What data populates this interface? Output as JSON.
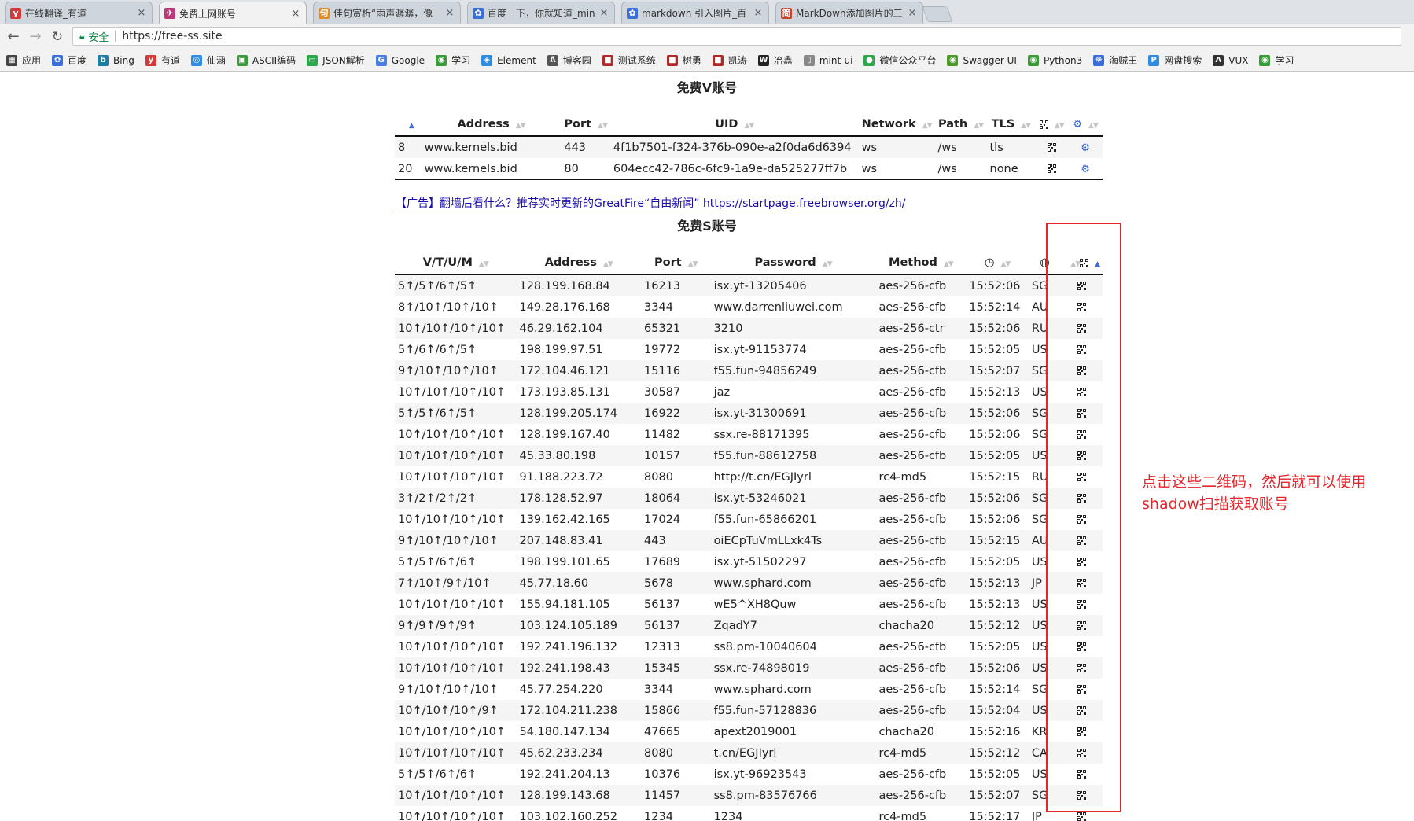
{
  "browser": {
    "tabs": [
      {
        "title": "在线翻译_有道",
        "icon_color": "#d43a3a",
        "icon": "y"
      },
      {
        "title": "免费上网账号",
        "icon_color": "#b83a78",
        "icon": "✈",
        "active": true
      },
      {
        "title": "佳句赏析“雨声潺潺，像",
        "icon_color": "#e08a2a",
        "icon": "句"
      },
      {
        "title": "百度一下，你就知道_min",
        "icon_color": "#3b6fd8",
        "icon": "✿"
      },
      {
        "title": "markdown 引入图片_百",
        "icon_color": "#3b6fd8",
        "icon": "✿"
      },
      {
        "title": "MarkDown添加图片的三",
        "icon_color": "#c8402e",
        "icon": "简"
      }
    ],
    "tab_close": "×",
    "security_label": "安全",
    "url": "https://free-ss.site",
    "bookmarks": [
      {
        "label": "应用",
        "color": "#444",
        "icon": "▦"
      },
      {
        "label": "百度",
        "color": "#3b6fd8",
        "icon": "✿"
      },
      {
        "label": "Bing",
        "color": "#1f7ea6",
        "icon": "b"
      },
      {
        "label": "有道",
        "color": "#d43a3a",
        "icon": "y"
      },
      {
        "label": "仙涵",
        "color": "#2f8be0",
        "icon": "◎"
      },
      {
        "label": "ASCII编码",
        "color": "#3a9a3a",
        "icon": "▣"
      },
      {
        "label": "JSON解析",
        "color": "#2aa84a",
        "icon": "▭"
      },
      {
        "label": "Google",
        "color": "#4a7de0",
        "icon": "G"
      },
      {
        "label": "学习",
        "color": "#3a9a3a",
        "icon": "◉"
      },
      {
        "label": "Element",
        "color": "#2f8be0",
        "icon": "◈"
      },
      {
        "label": "博客园",
        "color": "#555",
        "icon": "ᕕ"
      },
      {
        "label": "测试系统",
        "color": "#b02a2a",
        "icon": "■"
      },
      {
        "label": "树勇",
        "color": "#b02a2a",
        "icon": "■"
      },
      {
        "label": "凯涛",
        "color": "#b02a2a",
        "icon": "■"
      },
      {
        "label": "冶鑫",
        "color": "#222",
        "icon": "W"
      },
      {
        "label": "mint-ui",
        "color": "#888",
        "icon": "▯"
      },
      {
        "label": "微信公众平台",
        "color": "#2aa84a",
        "icon": "●"
      },
      {
        "label": "Swagger UI",
        "color": "#4a9a2a",
        "icon": "◉"
      },
      {
        "label": "Python3",
        "color": "#3a9a3a",
        "icon": "◉"
      },
      {
        "label": "海贼王",
        "color": "#3a6fd8",
        "icon": "☸"
      },
      {
        "label": "网盘搜索",
        "color": "#2f8be0",
        "icon": "P"
      },
      {
        "label": "VUX",
        "color": "#333",
        "icon": "Λ"
      },
      {
        "label": "学习",
        "color": "#3a9a3a",
        "icon": "◉"
      }
    ]
  },
  "v_section": {
    "title": "免费V账号",
    "headers": [
      "",
      "Address",
      "Port",
      "UID",
      "Network",
      "Path",
      "TLS",
      "",
      ""
    ],
    "rows": [
      [
        "8",
        "www.kernels.bid",
        "443",
        "4f1b7501-f324-376b-090e-a2f0da6d6394",
        "ws",
        "/ws",
        "tls"
      ],
      [
        "20",
        "www.kernels.bid",
        "80",
        "604ecc42-786c-6fc9-1a9e-da525277ff7b",
        "ws",
        "/ws",
        "none"
      ]
    ]
  },
  "ad": {
    "text": "【广告】翻墙后看什么？推荐实时更新的GreatFire“自由新闻”  https://startpage.freebrowser.org/zh/"
  },
  "s_section": {
    "title": "免费S账号",
    "headers": [
      "V/T/U/M",
      "Address",
      "Port",
      "Password",
      "Method",
      "",
      "",
      ""
    ],
    "rows": [
      [
        "5↑/5↑/6↑/5↑",
        "128.199.168.84",
        "16213",
        "isx.yt-13205406",
        "aes-256-cfb",
        "15:52:06",
        "SG"
      ],
      [
        "8↑/10↑/10↑/10↑",
        "149.28.176.168",
        "3344",
        "www.darrenliuwei.com",
        "aes-256-cfb",
        "15:52:14",
        "AU"
      ],
      [
        "10↑/10↑/10↑/10↑",
        "46.29.162.104",
        "65321",
        "3210",
        "aes-256-ctr",
        "15:52:06",
        "RU"
      ],
      [
        "5↑/6↑/6↑/5↑",
        "198.199.97.51",
        "19772",
        "isx.yt-91153774",
        "aes-256-cfb",
        "15:52:05",
        "US"
      ],
      [
        "9↑/10↑/10↑/10↑",
        "172.104.46.121",
        "15116",
        "f55.fun-94856249",
        "aes-256-cfb",
        "15:52:07",
        "SG"
      ],
      [
        "10↑/10↑/10↑/10↑",
        "173.193.85.131",
        "30587",
        "jaz",
        "aes-256-cfb",
        "15:52:13",
        "US"
      ],
      [
        "5↑/5↑/6↑/5↑",
        "128.199.205.174",
        "16922",
        "isx.yt-31300691",
        "aes-256-cfb",
        "15:52:06",
        "SG"
      ],
      [
        "10↑/10↑/10↑/10↑",
        "128.199.167.40",
        "11482",
        "ssx.re-88171395",
        "aes-256-cfb",
        "15:52:06",
        "SG"
      ],
      [
        "10↑/10↑/10↑/10↑",
        "45.33.80.198",
        "10157",
        "f55.fun-88612758",
        "aes-256-cfb",
        "15:52:05",
        "US"
      ],
      [
        "10↑/10↑/10↑/10↑",
        "91.188.223.72",
        "8080",
        "http://t.cn/EGJIyrl",
        "rc4-md5",
        "15:52:15",
        "RU"
      ],
      [
        "3↑/2↑/2↑/2↑",
        "178.128.52.97",
        "18064",
        "isx.yt-53246021",
        "aes-256-cfb",
        "15:52:06",
        "SG"
      ],
      [
        "10↑/10↑/10↑/10↑",
        "139.162.42.165",
        "17024",
        "f55.fun-65866201",
        "aes-256-cfb",
        "15:52:06",
        "SG"
      ],
      [
        "9↑/10↑/10↑/10↑",
        "207.148.83.41",
        "443",
        "oiECpTuVmLLxk4Ts",
        "aes-256-cfb",
        "15:52:15",
        "AU"
      ],
      [
        "5↑/5↑/6↑/6↑",
        "198.199.101.65",
        "17689",
        "isx.yt-51502297",
        "aes-256-cfb",
        "15:52:05",
        "US"
      ],
      [
        "7↑/10↑/9↑/10↑",
        "45.77.18.60",
        "5678",
        "www.sphard.com",
        "aes-256-cfb",
        "15:52:13",
        "JP"
      ],
      [
        "10↑/10↑/10↑/10↑",
        "155.94.181.105",
        "56137",
        "wE5^XH8Quw",
        "aes-256-cfb",
        "15:52:13",
        "US"
      ],
      [
        "9↑/9↑/9↑/9↑",
        "103.124.105.189",
        "56137",
        "ZqadY7",
        "chacha20",
        "15:52:12",
        "US"
      ],
      [
        "10↑/10↑/10↑/10↑",
        "192.241.196.132",
        "12313",
        "ss8.pm-10040604",
        "aes-256-cfb",
        "15:52:05",
        "US"
      ],
      [
        "10↑/10↑/10↑/10↑",
        "192.241.198.43",
        "15345",
        "ssx.re-74898019",
        "aes-256-cfb",
        "15:52:06",
        "US"
      ],
      [
        "9↑/10↑/10↑/10↑",
        "45.77.254.220",
        "3344",
        "www.sphard.com",
        "aes-256-cfb",
        "15:52:14",
        "SG"
      ],
      [
        "10↑/10↑/10↑/9↑",
        "172.104.211.238",
        "15866",
        "f55.fun-57128836",
        "aes-256-cfb",
        "15:52:04",
        "US"
      ],
      [
        "10↑/10↑/10↑/10↑",
        "54.180.147.134",
        "47665",
        "apext2019001",
        "chacha20",
        "15:52:16",
        "KR"
      ],
      [
        "10↑/10↑/10↑/10↑",
        "45.62.233.234",
        "8080",
        "t.cn/EGJIyrl",
        "rc4-md5",
        "15:52:12",
        "CA"
      ],
      [
        "5↑/5↑/6↑/6↑",
        "192.241.204.13",
        "10376",
        "isx.yt-96923543",
        "aes-256-cfb",
        "15:52:05",
        "US"
      ],
      [
        "10↑/10↑/10↑/10↑",
        "128.199.143.68",
        "11457",
        "ss8.pm-83576766",
        "aes-256-cfb",
        "15:52:07",
        "SG"
      ],
      [
        "10↑/10↑/10↑/10↑",
        "103.102.160.252",
        "1234",
        "1234",
        "rc4-md5",
        "15:52:17",
        "JP"
      ]
    ]
  },
  "annotation": {
    "text": "点击这些二维码，然后就可以使用shadow扫描获取账号",
    "color": "#e4252a"
  }
}
